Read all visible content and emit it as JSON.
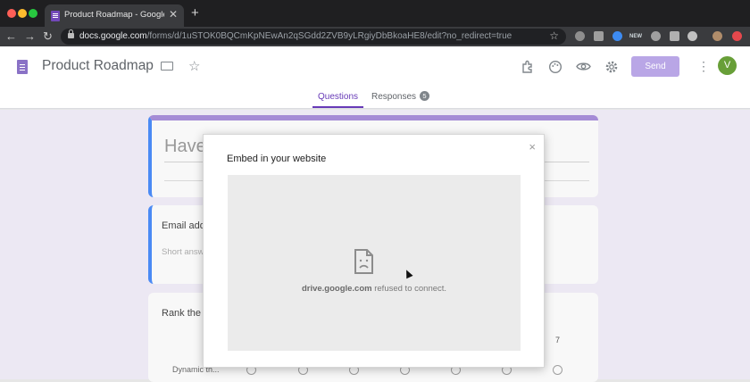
{
  "browser": {
    "tab_title": "Product Roadmap - Google Forms",
    "tab_close": "✕",
    "new_tab": "+",
    "url_host": "docs.google.com",
    "url_path": "/forms/d/1uSTOK0BQCmKpNEwAn2qSGdd2ZVB9yLRgiyDbBkoaHE8/edit?no_redirect=true",
    "back": "←",
    "forward": "→",
    "reload": "↻",
    "bookmark": "☆",
    "extension_badge": "NEW"
  },
  "header": {
    "title": "Product Roadmap",
    "star": "☆",
    "send_label": "Send",
    "avatar_letter": "V",
    "icons": [
      "puzzle-icon",
      "palette-icon",
      "eye-icon",
      "gear-icon"
    ]
  },
  "form_tabs": {
    "questions": "Questions",
    "responses": "Responses",
    "responses_count": "5"
  },
  "form": {
    "title_partial": "Have",
    "question1": "Email add",
    "answer1_placeholder": "Short answ",
    "question2": "Rank the",
    "scale_max": "7",
    "row_label": "Dynamic th..."
  },
  "modal": {
    "title": "Embed in your website",
    "close": "×",
    "error_host": "drive.google.com",
    "error_message": " refused to connect."
  }
}
